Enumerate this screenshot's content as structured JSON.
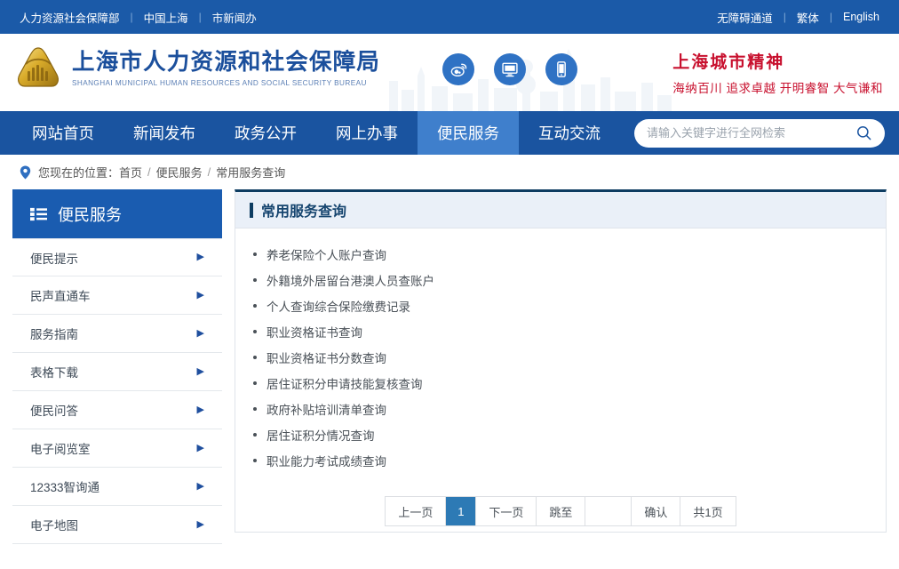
{
  "topbar": {
    "left_links": [
      "人力资源社会保障部",
      "中国上海",
      "市新闻办"
    ],
    "right_links": [
      "无障碍通道",
      "繁体",
      "English"
    ],
    "separator": "|",
    "bg_color": "#1b5aa8"
  },
  "header": {
    "logo_icon": "shanghai-hrss-emblem-icon",
    "title_cn": "上海市人力资源和社会保障局",
    "title_en": "SHANGHAI MUNICIPAL HUMAN RESOURCES AND SOCIAL SECURITY BUREAU",
    "title_color": "#1b4f9c",
    "social": [
      {
        "name": "weibo-icon",
        "label": "微博"
      },
      {
        "name": "desktop-icon",
        "label": "网站"
      },
      {
        "name": "mobile-icon",
        "label": "手机版"
      }
    ],
    "slogan_title": "上海城市精神",
    "slogan_sub": "海纳百川 追求卓越 开明睿智 大气谦和",
    "slogan_color": "#c8102e"
  },
  "nav": {
    "items": [
      {
        "label": "网站首页",
        "active": false
      },
      {
        "label": "新闻发布",
        "active": false
      },
      {
        "label": "政务公开",
        "active": false
      },
      {
        "label": "网上办事",
        "active": false
      },
      {
        "label": "便民服务",
        "active": true
      },
      {
        "label": "互动交流",
        "active": false
      }
    ],
    "bg_color": "#1a54a0",
    "active_bg_color": "#3f7fcc"
  },
  "search": {
    "placeholder": "请输入关键字进行全网检索",
    "value": "",
    "icon": "search-icon"
  },
  "breadcrumb": {
    "icon": "location-pin-icon",
    "prefix": "您现在的位置：",
    "items": [
      "首页",
      "便民服务",
      "常用服务查询"
    ],
    "separator": "/"
  },
  "sidebar": {
    "title": "便民服务",
    "title_icon": "list-icon",
    "items": [
      {
        "label": "便民提示",
        "arrow": "▶"
      },
      {
        "label": "民声直通车",
        "arrow": "▶"
      },
      {
        "label": "服务指南",
        "arrow": "▶"
      },
      {
        "label": "表格下载",
        "arrow": "▶"
      },
      {
        "label": "便民问答",
        "arrow": "▶"
      },
      {
        "label": "电子阅览室",
        "arrow": "▶"
      },
      {
        "label": "12333智询通",
        "arrow": "▶"
      },
      {
        "label": "电子地图",
        "arrow": "▶"
      }
    ]
  },
  "panel": {
    "title": "常用服务查询",
    "accent_color": "#0d3c61",
    "items": [
      "养老保险个人账户查询",
      "外籍境外居留台港澳人员查账户",
      "个人查询综合保险缴费记录",
      "职业资格证书查询",
      "职业资格证书分数查询",
      "居住证积分申请技能复核查询",
      "政府补贴培训清单查询",
      "居住证积分情况查询",
      "职业能力考试成绩查询"
    ]
  },
  "pagination": {
    "prev": "上一页",
    "current_page": "1",
    "next": "下一页",
    "jump_label": "跳至",
    "jump_value": "",
    "confirm": "确认",
    "total": "共1页",
    "active_bg_color": "#2d7ab5"
  }
}
